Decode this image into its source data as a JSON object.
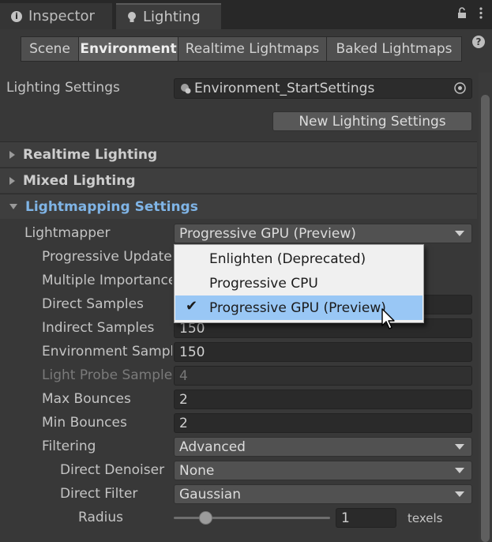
{
  "tabs": {
    "inspector": "Inspector",
    "lighting": "Lighting"
  },
  "modes": [
    "Scene",
    "Environment",
    "Realtime Lightmaps",
    "Baked Lightmaps"
  ],
  "lighting_settings": {
    "label": "Lighting Settings",
    "asset": "Environment_StartSettings",
    "new_button": "New Lighting Settings"
  },
  "sections": {
    "realtime": "Realtime Lighting",
    "mixed": "Mixed Lighting",
    "lightmapping": "Lightmapping Settings"
  },
  "lightmapper": {
    "label": "Lightmapper",
    "value": "Progressive GPU (Preview)"
  },
  "rows": {
    "progressive_updates": "Progressive Updates",
    "multiple_importance": "Multiple Importance Sampling",
    "direct_samples": "Direct Samples",
    "indirect_samples": {
      "label": "Indirect Samples",
      "value": "150"
    },
    "environment_samples": {
      "label": "Environment Samples",
      "value": "150"
    },
    "light_probe_samples": {
      "label": "Light Probe Sample Multiplier",
      "value": "4"
    },
    "max_bounces": {
      "label": "Max Bounces",
      "value": "2"
    },
    "min_bounces": {
      "label": "Min Bounces",
      "value": "2"
    },
    "filtering": {
      "label": "Filtering",
      "value": "Advanced"
    },
    "direct_denoiser": {
      "label": "Direct Denoiser",
      "value": "None"
    },
    "direct_filter": {
      "label": "Direct Filter",
      "value": "Gaussian"
    },
    "radius": {
      "label": "Radius",
      "value": "1",
      "unit": "texels",
      "level": 0.2
    }
  },
  "popup": {
    "items": [
      "Enlighten (Deprecated)",
      "Progressive CPU",
      "Progressive GPU (Preview)"
    ],
    "selected_index": 2
  },
  "icons": {
    "inspector": "info-icon",
    "lighting": "lightbulb-icon",
    "lock": "lock-icon",
    "menu": "kebab-menu-icon",
    "help": "help-icon",
    "asset": "settings-asset-icon",
    "picker": "object-picker-icon"
  },
  "colors": {
    "panel_bg": "#383838",
    "section_title_active": "#7fb4e6",
    "menu_selected": "#99c7f5"
  }
}
